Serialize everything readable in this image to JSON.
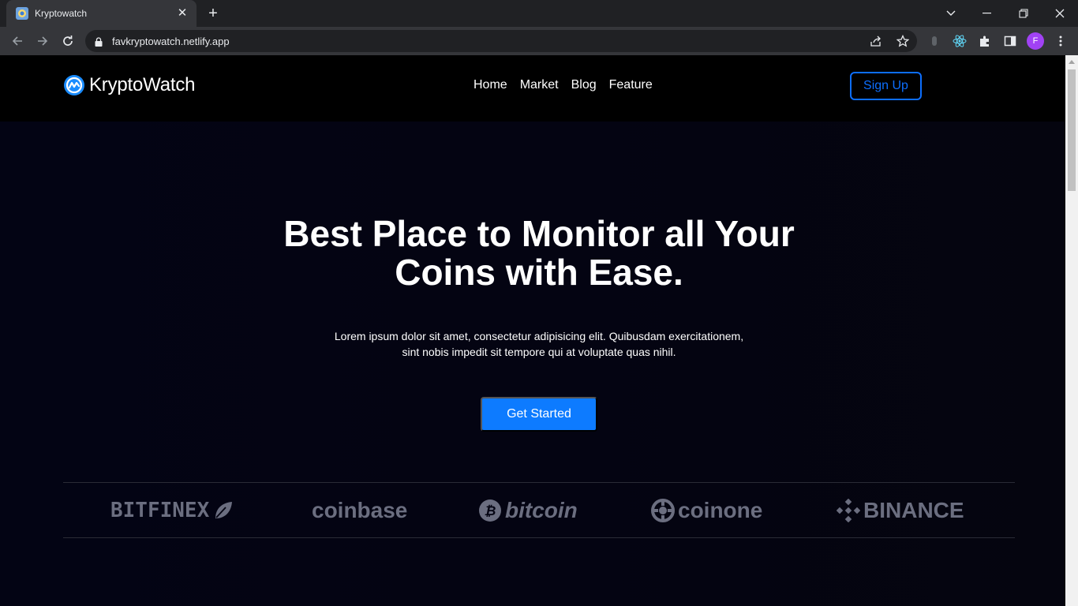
{
  "browser": {
    "tab_title": "Kryptowatch",
    "url": "favkryptowatch.netlify.app",
    "profile_initial": "F"
  },
  "site": {
    "logo_text": "KryptoWatch",
    "nav": [
      "Home",
      "Market",
      "Blog",
      "Feature"
    ],
    "signup_label": "Sign Up"
  },
  "hero": {
    "title_line1": "Best Place to Monitor all Your",
    "title_line2": "Coins with Ease.",
    "subtitle_line1": "Lorem ipsum dolor sit amet, consectetur adipisicing elit. Quibusdam exercitationem,",
    "subtitle_line2": "sint nobis impedit sit tempore qui at voluptate quas nihil.",
    "cta_label": "Get Started"
  },
  "brands": [
    "BITFINEX",
    "coinbase",
    "bitcoin",
    "coinone",
    "BINANCE"
  ],
  "colors": {
    "accent": "#0d6efd",
    "cta": "#0d7bff",
    "brand_gray": "#6b6e80",
    "hero_bg": "#040412"
  }
}
